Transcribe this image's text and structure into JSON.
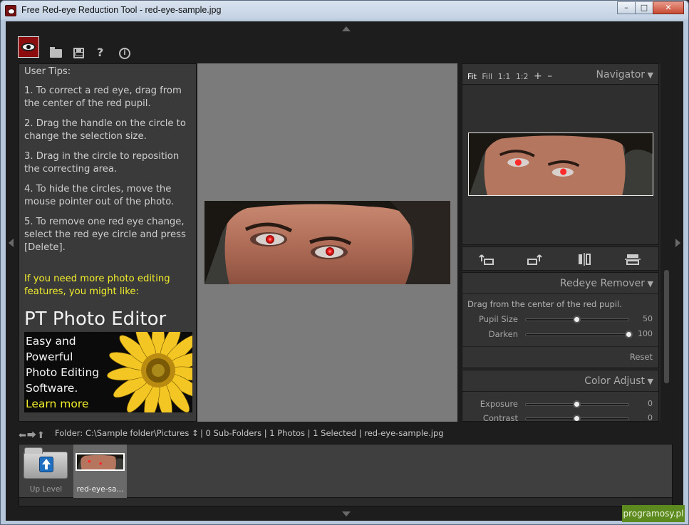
{
  "window": {
    "title": "Free Red-eye Reduction Tool - red-eye-sample.jpg",
    "controls": {
      "minimize": "–",
      "maximize": "□",
      "close": "✕"
    }
  },
  "toolbar": {
    "icons": [
      "app-logo-icon",
      "open-folder-icon",
      "save-icon",
      "help-icon",
      "info-icon"
    ],
    "help_glyph": "?",
    "info_glyph": "i"
  },
  "tips": {
    "heading": "User Tips:",
    "items": [
      "1. To correct a red eye, drag from the center of the red pupil.",
      "2. Drag the handle on the circle to change the selection size.",
      "3. Drag in the circle to reposition the correcting area.",
      "4. To hide the circles, move the mouse pointer out of the photo.",
      "5. To remove one red eye change, select the red eye circle and press [Delete]."
    ],
    "promo": "If you need more photo editing features, you might like:",
    "ad_title": "PT Photo Editor",
    "ad_lines": [
      "Easy and",
      "Powerful",
      "Photo Editing",
      "Software."
    ],
    "ad_link": "Learn more"
  },
  "navigator": {
    "title": "Navigator",
    "zoom_options": [
      "Fit",
      "Fill",
      "1:1",
      "1:2"
    ],
    "zoom_in": "+",
    "zoom_out": "–"
  },
  "redeye": {
    "title": "Redeye Remover",
    "hint": "Drag from the center of the red pupil.",
    "pupil_label": "Pupil Size",
    "pupil_value": "50",
    "pupil_level": 0.5,
    "darken_label": "Darken",
    "darken_value": "100",
    "darken_level": 1.0,
    "reset": "Reset"
  },
  "color_adjust": {
    "title": "Color Adjust",
    "exposure_label": "Exposure",
    "exposure_value": "0",
    "exposure_level": 0.5,
    "contrast_label": "Contrast",
    "contrast_value": "0"
  },
  "folder": {
    "label": "Folder:",
    "path": "C:\\Sample folder\\Pictures ↕",
    "info": "| 0 Sub-Folders | 1 Photos | 1 Selected | red-eye-sample.jpg"
  },
  "filmstrip": {
    "up_label": "Up Level",
    "file_label": "red-eye-sa..."
  },
  "watermark": "programosy.pl",
  "colors": {
    "accent_yellow": "#f2ee2b",
    "red_eye": "#ff2a2a",
    "panel": "#333333"
  }
}
